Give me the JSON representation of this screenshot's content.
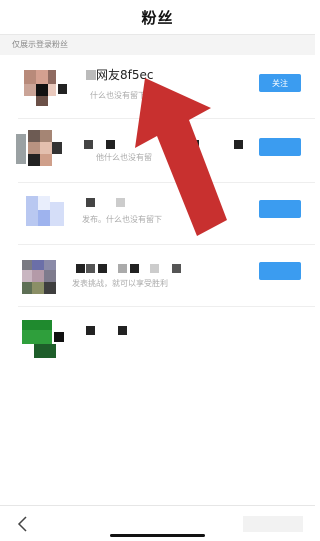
{
  "header": {
    "title": "粉丝"
  },
  "notice": {
    "text": "仅展示登录粉丝"
  },
  "fans": [
    {
      "name": "网友8f5ec",
      "subtitle": "什么也没有留下",
      "button": "关注"
    },
    {
      "name": "",
      "subtitle": "他什么也没有留",
      "button": ""
    },
    {
      "name": "",
      "subtitle": "发布。什么也没有留下",
      "button": ""
    },
    {
      "name": "",
      "subtitle": "发表挑战，就可以享受胜利",
      "button": ""
    },
    {
      "name": "",
      "subtitle": "",
      "button": ""
    }
  ],
  "icons": {
    "back": "back-arrow-icon"
  },
  "colors": {
    "accent": "#3b9cf0",
    "arrow": "#c8302f"
  }
}
